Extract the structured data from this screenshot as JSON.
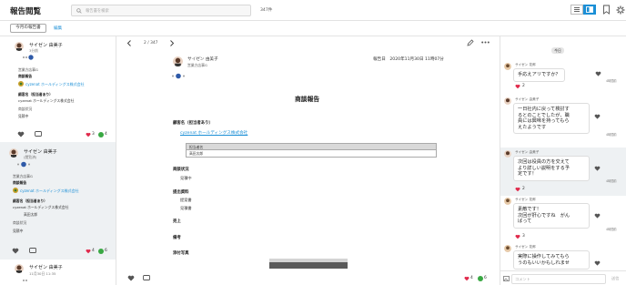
{
  "header": {
    "title": "報告閲覧",
    "search_placeholder": "報告書を検索",
    "count": "347件"
  },
  "tabs": {
    "this_month": "今月の報告書",
    "edit": "編集"
  },
  "left_list": [
    {
      "name": "サイゼン 由美子",
      "time": "3分前",
      "dept": "営業方店事G",
      "type": "商談報告",
      "company": "cyzenat ホールディングス株式会社",
      "customer_label": "顧客名（担当者あり）",
      "customer": "cyzenat ホールディングス株式会社",
      "status_label": "商談状況",
      "status": "見積中",
      "hearts": "3",
      "comments": "4"
    },
    {
      "name": "サイゼン 由美子",
      "time": "(閲覧済)",
      "dept": "営業方店事G",
      "type": "商談報告",
      "company": "cyzenat ホールディングス株式会社",
      "customer_label": "顧客名（担当者あり）",
      "customer": "cyzenat ホールディングス株式会社",
      "contact": "高田太郎",
      "status_label": "商談状況",
      "status": "見積中",
      "hearts": "4",
      "comments": "6"
    },
    {
      "name": "サイゼン 由美子",
      "time": "11月30日 11:35"
    }
  ],
  "document": {
    "pager": "2 / 347",
    "author": "サイゼン 由美子",
    "dept": "営業方店事G",
    "date": "報告日　2020年11月30日 11時07分",
    "heading": "商談報告",
    "sec_customer": "顧客名（担当者あり）",
    "customer_link": "cyzenat ホールディングス株式会社",
    "table_header": "担当者名",
    "table_value": "高田太郎",
    "sec_status": "商談状況",
    "status": "見積中",
    "sec_materials": "提出資料",
    "material_1": "提案書",
    "material_2": "見積書",
    "sec_sales": "売上",
    "sec_notes": "備考",
    "sec_photo": "添付写真",
    "hearts": "4",
    "comments": "6"
  },
  "comments": {
    "date_pill": "今日",
    "items": [
      {
        "user": "サイゼン 花郎",
        "text": "手応えアリですか？",
        "hearts": "2",
        "ts": "4時間前"
      },
      {
        "user": "サイゼン 由美子",
        "text_lines": [
          "一日社内に戻って検討す",
          "るとのことでしたが、職",
          "員には興味を持ってもら",
          "えたようです"
        ],
        "ts": "4時間前"
      },
      {
        "user": "サイゼン 由美子",
        "text_lines": [
          "次回は役員の方を交えて",
          "より詳しい説明をする予",
          "定です！"
        ],
        "hearts": "2",
        "ts": "4時間前"
      },
      {
        "user": "サイゼン 花郎",
        "text_lines": [
          "素敵です！",
          "次回が肝心ですね　がん",
          "ばって"
        ],
        "hearts": "3",
        "ts": "4時間前"
      },
      {
        "user": "サイゼン 花郎",
        "text_lines": [
          "実際に操作してみてもら",
          "うのもいいかもしれませ"
        ]
      }
    ],
    "input_placeholder": "コメント",
    "send": "送信"
  },
  "colors": {
    "accent": "#1b8fd6",
    "heart": "#e0284a",
    "comment": "#39a843",
    "selected_bg": "#eef1f3"
  }
}
